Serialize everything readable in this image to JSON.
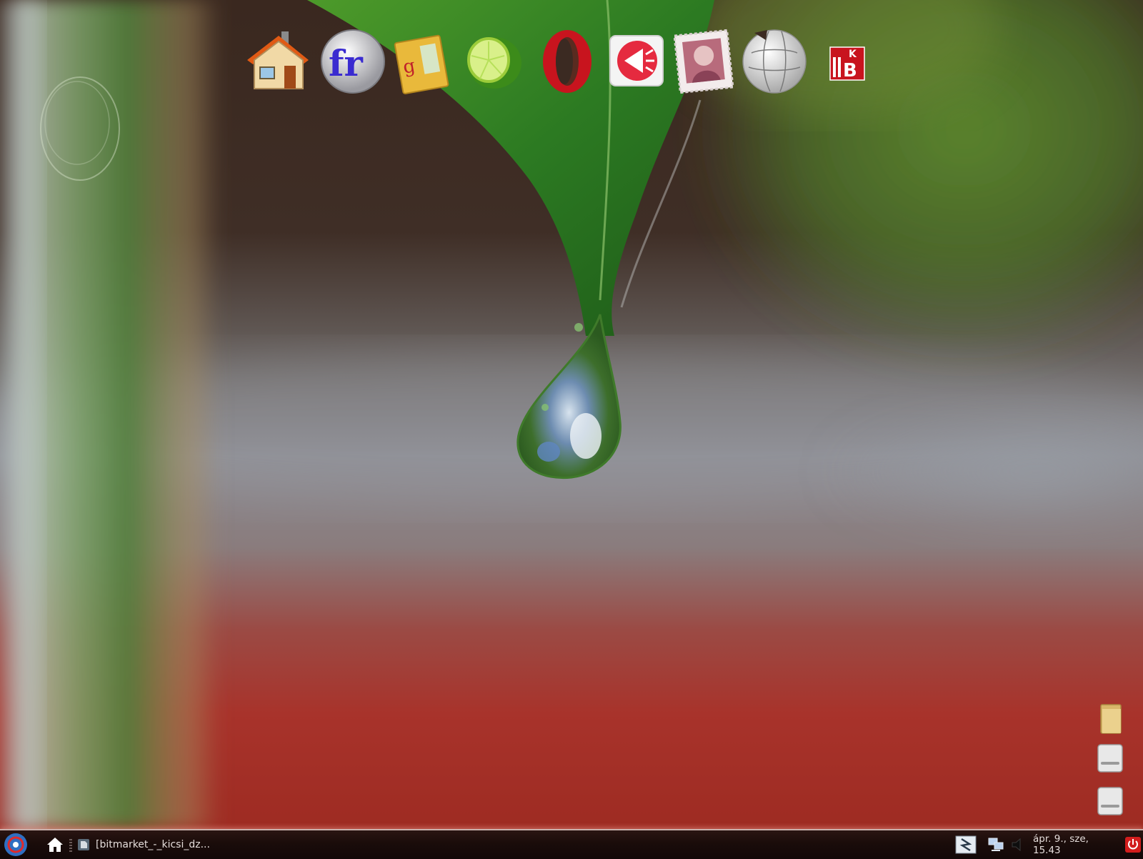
{
  "desktop": {
    "dock": [
      {
        "name": "home-icon"
      },
      {
        "name": "font-fr-icon",
        "text": "fr"
      },
      {
        "name": "envelope-g-icon",
        "text": "g"
      },
      {
        "name": "lime-icon"
      },
      {
        "name": "opera-browser-icon"
      },
      {
        "name": "speaker-announce-icon"
      },
      {
        "name": "postage-stamp-icon"
      },
      {
        "name": "wikipedia-globe-icon"
      },
      {
        "name": "kb-logo-icon",
        "text": "KB"
      }
    ],
    "right_column": [
      {
        "name": "folder-icon"
      },
      {
        "name": "drive-icon"
      },
      {
        "name": "drive-icon-2"
      }
    ]
  },
  "taskbar": {
    "task_window_title": "[bitmarket_-_kicsi_dz...",
    "clock": "ápr.  9., sze, 15.43"
  },
  "colors": {
    "taskbar_bg": "#1a0c0a",
    "leaf_green": "#2f7a26",
    "wall_red": "#a8322a"
  }
}
